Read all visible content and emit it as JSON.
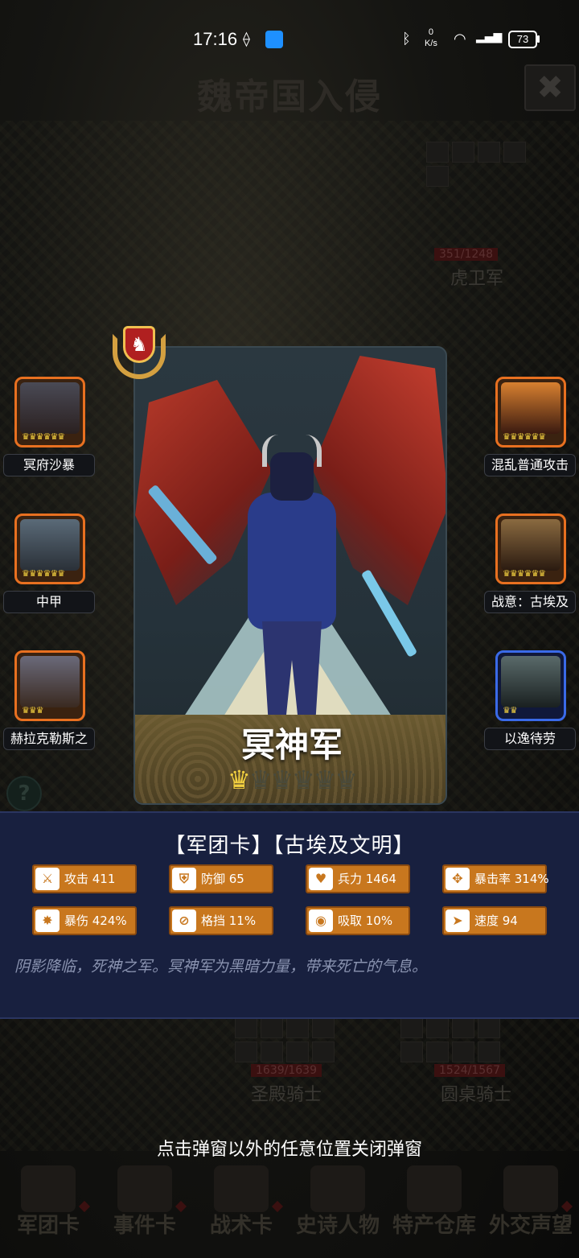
{
  "status_bar": {
    "time": "17:16",
    "net_speed_value": "0",
    "net_speed_unit": "K/s",
    "battery": "73"
  },
  "background": {
    "title": "魏帝国入侵",
    "close_glyph": "✖",
    "help_glyph": "?",
    "units": [
      {
        "hp": "351/1248",
        "name": "虎卫军"
      },
      {
        "hp": "1639/1639",
        "name": "圣殿骑士"
      },
      {
        "hp": "1524/1567",
        "name": "圆桌骑士"
      }
    ]
  },
  "left_skills": [
    {
      "label": "冥府沙暴",
      "crowns": "♛♛♛♛♛♛"
    },
    {
      "label": "中甲",
      "crowns": "♛♛♛♛♛♛"
    },
    {
      "label": "赫拉克勒斯之",
      "crowns": "♛♛♛"
    }
  ],
  "right_skills": [
    {
      "label": "混乱普通攻击",
      "crowns": "♛♛♛♛♛♛"
    },
    {
      "label": "战意：古埃及",
      "crowns": "♛♛♛♛♛♛"
    },
    {
      "label": "以逸待劳",
      "crowns": "♛♛"
    }
  ],
  "card": {
    "name": "冥神军",
    "stars_filled": 1,
    "stars_total": 6,
    "badge_glyph": "♞"
  },
  "info": {
    "tags": "【军团卡】【古埃及文明】",
    "stats": [
      {
        "icon": "sword-icon",
        "glyph": "⚔",
        "text": "攻击 411"
      },
      {
        "icon": "shield-icon",
        "glyph": "⛨",
        "text": "防御 65"
      },
      {
        "icon": "heart-icon",
        "glyph": "♥",
        "text": "兵力 1464"
      },
      {
        "icon": "crosshair-icon",
        "glyph": "✥",
        "text": "暴击率 314%"
      },
      {
        "icon": "burst-icon",
        "glyph": "✸",
        "text": "暴伤 424%"
      },
      {
        "icon": "block-icon",
        "glyph": "⊘",
        "text": "格挡 11%"
      },
      {
        "icon": "absorb-icon",
        "glyph": "◉",
        "text": "吸取 10%"
      },
      {
        "icon": "boot-icon",
        "glyph": "➤",
        "text": "速度 94"
      }
    ],
    "description": "阴影降临，死神之军。冥神军为黑暗力量，带来死亡的气息。"
  },
  "hint": "点击弹窗以外的任意位置关闭弹窗",
  "bottom_nav": [
    {
      "label": "军团卡"
    },
    {
      "label": "事件卡"
    },
    {
      "label": "战术卡"
    },
    {
      "label": "史诗人物"
    },
    {
      "label": "特产仓库"
    },
    {
      "label": "外交声望"
    }
  ],
  "colors": {
    "accent_orange": "#c8771e",
    "panel_blue": "#18203f",
    "crown_gold": "#f2d040",
    "skill_border_orange": "#e87020",
    "skill_border_blue": "#3a6ae8"
  }
}
